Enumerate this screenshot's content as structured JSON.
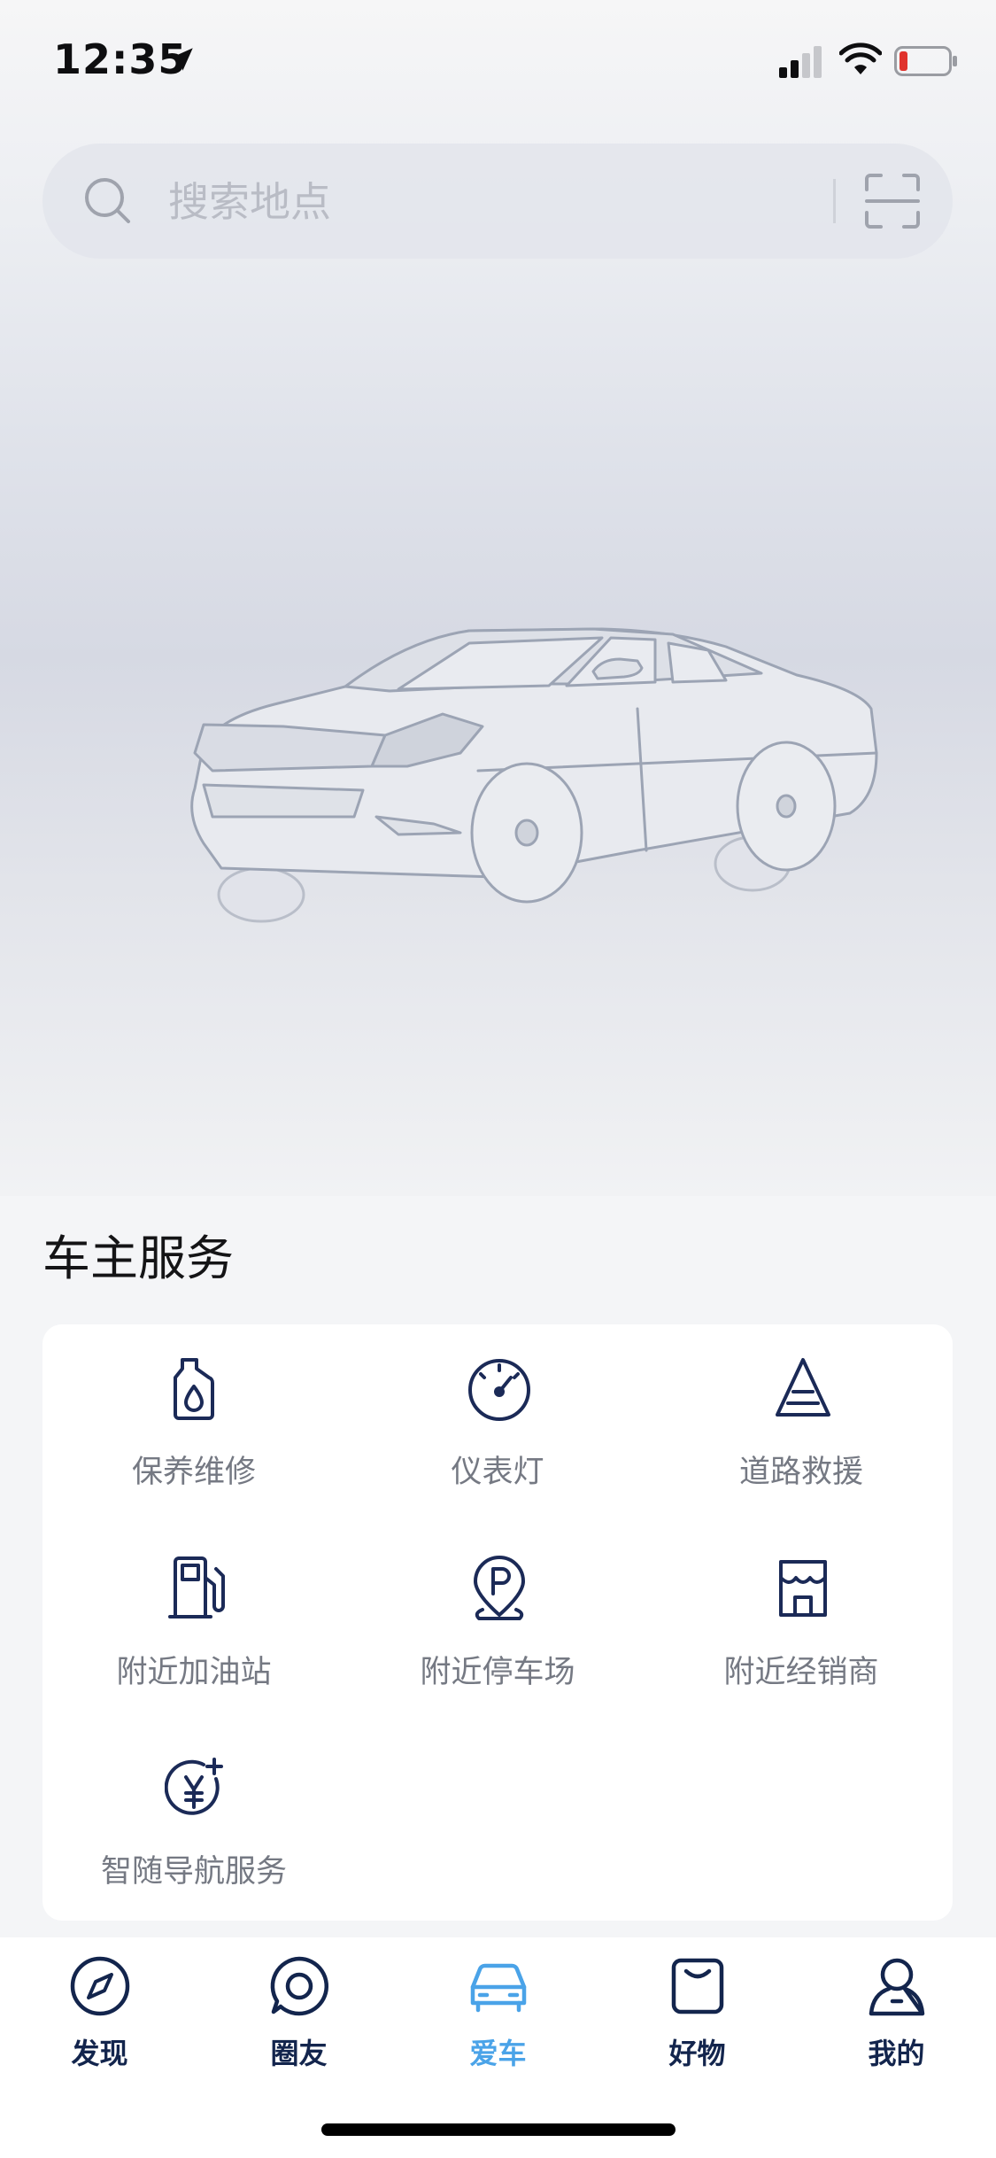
{
  "status_bar": {
    "time": "12:35"
  },
  "search": {
    "placeholder": "搜索地点",
    "value": ""
  },
  "services": {
    "title": "车主服务",
    "items": [
      {
        "label": "保养维修",
        "icon": "oil-bottle-icon"
      },
      {
        "label": "仪表灯",
        "icon": "gauge-icon"
      },
      {
        "label": "道路救援",
        "icon": "warning-triangle-icon"
      },
      {
        "label": "附近加油站",
        "icon": "fuel-pump-icon"
      },
      {
        "label": "附近停车场",
        "icon": "parking-pin-icon"
      },
      {
        "label": "附近经销商",
        "icon": "store-icon"
      },
      {
        "label": "智随导航服务",
        "icon": "yen-plus-icon"
      }
    ]
  },
  "tabs": [
    {
      "label": "发现",
      "icon": "compass-icon",
      "active": false
    },
    {
      "label": "圈友",
      "icon": "chat-bubble-icon",
      "active": false
    },
    {
      "label": "爱车",
      "icon": "car-icon",
      "active": true
    },
    {
      "label": "好物",
      "icon": "bag-icon",
      "active": false
    },
    {
      "label": "我的",
      "icon": "profile-icon",
      "active": false
    }
  ],
  "colors": {
    "icon_navy": "#1b2a57",
    "tab_active": "#4aa3e8",
    "label_gray": "#757983"
  }
}
